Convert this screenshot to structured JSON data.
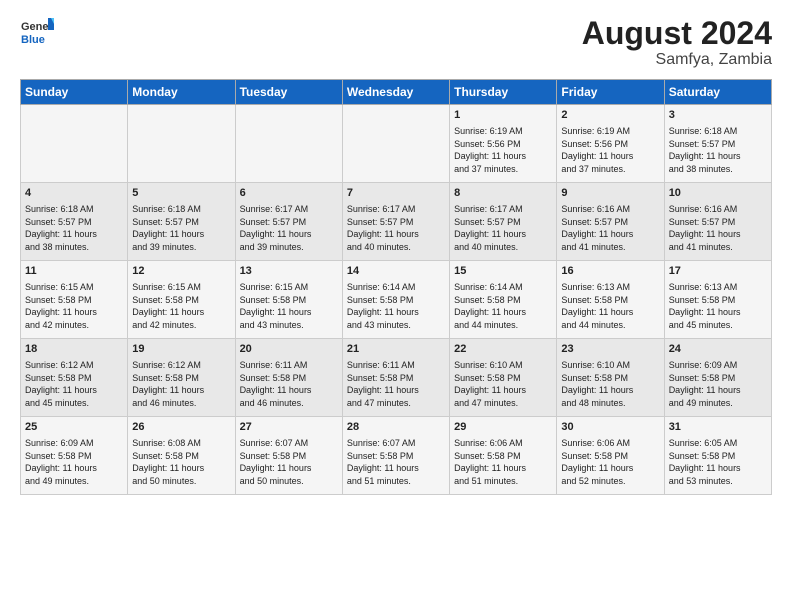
{
  "logo": {
    "general": "General",
    "blue": "Blue"
  },
  "title": "August 2024",
  "subtitle": "Samfya, Zambia",
  "days_of_week": [
    "Sunday",
    "Monday",
    "Tuesday",
    "Wednesday",
    "Thursday",
    "Friday",
    "Saturday"
  ],
  "weeks": [
    [
      {
        "day": "",
        "content": ""
      },
      {
        "day": "",
        "content": ""
      },
      {
        "day": "",
        "content": ""
      },
      {
        "day": "",
        "content": ""
      },
      {
        "day": "1",
        "content": "Sunrise: 6:19 AM\nSunset: 5:56 PM\nDaylight: 11 hours\nand 37 minutes."
      },
      {
        "day": "2",
        "content": "Sunrise: 6:19 AM\nSunset: 5:56 PM\nDaylight: 11 hours\nand 37 minutes."
      },
      {
        "day": "3",
        "content": "Sunrise: 6:18 AM\nSunset: 5:57 PM\nDaylight: 11 hours\nand 38 minutes."
      }
    ],
    [
      {
        "day": "4",
        "content": "Sunrise: 6:18 AM\nSunset: 5:57 PM\nDaylight: 11 hours\nand 38 minutes."
      },
      {
        "day": "5",
        "content": "Sunrise: 6:18 AM\nSunset: 5:57 PM\nDaylight: 11 hours\nand 39 minutes."
      },
      {
        "day": "6",
        "content": "Sunrise: 6:17 AM\nSunset: 5:57 PM\nDaylight: 11 hours\nand 39 minutes."
      },
      {
        "day": "7",
        "content": "Sunrise: 6:17 AM\nSunset: 5:57 PM\nDaylight: 11 hours\nand 40 minutes."
      },
      {
        "day": "8",
        "content": "Sunrise: 6:17 AM\nSunset: 5:57 PM\nDaylight: 11 hours\nand 40 minutes."
      },
      {
        "day": "9",
        "content": "Sunrise: 6:16 AM\nSunset: 5:57 PM\nDaylight: 11 hours\nand 41 minutes."
      },
      {
        "day": "10",
        "content": "Sunrise: 6:16 AM\nSunset: 5:57 PM\nDaylight: 11 hours\nand 41 minutes."
      }
    ],
    [
      {
        "day": "11",
        "content": "Sunrise: 6:15 AM\nSunset: 5:58 PM\nDaylight: 11 hours\nand 42 minutes."
      },
      {
        "day": "12",
        "content": "Sunrise: 6:15 AM\nSunset: 5:58 PM\nDaylight: 11 hours\nand 42 minutes."
      },
      {
        "day": "13",
        "content": "Sunrise: 6:15 AM\nSunset: 5:58 PM\nDaylight: 11 hours\nand 43 minutes."
      },
      {
        "day": "14",
        "content": "Sunrise: 6:14 AM\nSunset: 5:58 PM\nDaylight: 11 hours\nand 43 minutes."
      },
      {
        "day": "15",
        "content": "Sunrise: 6:14 AM\nSunset: 5:58 PM\nDaylight: 11 hours\nand 44 minutes."
      },
      {
        "day": "16",
        "content": "Sunrise: 6:13 AM\nSunset: 5:58 PM\nDaylight: 11 hours\nand 44 minutes."
      },
      {
        "day": "17",
        "content": "Sunrise: 6:13 AM\nSunset: 5:58 PM\nDaylight: 11 hours\nand 45 minutes."
      }
    ],
    [
      {
        "day": "18",
        "content": "Sunrise: 6:12 AM\nSunset: 5:58 PM\nDaylight: 11 hours\nand 45 minutes."
      },
      {
        "day": "19",
        "content": "Sunrise: 6:12 AM\nSunset: 5:58 PM\nDaylight: 11 hours\nand 46 minutes."
      },
      {
        "day": "20",
        "content": "Sunrise: 6:11 AM\nSunset: 5:58 PM\nDaylight: 11 hours\nand 46 minutes."
      },
      {
        "day": "21",
        "content": "Sunrise: 6:11 AM\nSunset: 5:58 PM\nDaylight: 11 hours\nand 47 minutes."
      },
      {
        "day": "22",
        "content": "Sunrise: 6:10 AM\nSunset: 5:58 PM\nDaylight: 11 hours\nand 47 minutes."
      },
      {
        "day": "23",
        "content": "Sunrise: 6:10 AM\nSunset: 5:58 PM\nDaylight: 11 hours\nand 48 minutes."
      },
      {
        "day": "24",
        "content": "Sunrise: 6:09 AM\nSunset: 5:58 PM\nDaylight: 11 hours\nand 49 minutes."
      }
    ],
    [
      {
        "day": "25",
        "content": "Sunrise: 6:09 AM\nSunset: 5:58 PM\nDaylight: 11 hours\nand 49 minutes."
      },
      {
        "day": "26",
        "content": "Sunrise: 6:08 AM\nSunset: 5:58 PM\nDaylight: 11 hours\nand 50 minutes."
      },
      {
        "day": "27",
        "content": "Sunrise: 6:07 AM\nSunset: 5:58 PM\nDaylight: 11 hours\nand 50 minutes."
      },
      {
        "day": "28",
        "content": "Sunrise: 6:07 AM\nSunset: 5:58 PM\nDaylight: 11 hours\nand 51 minutes."
      },
      {
        "day": "29",
        "content": "Sunrise: 6:06 AM\nSunset: 5:58 PM\nDaylight: 11 hours\nand 51 minutes."
      },
      {
        "day": "30",
        "content": "Sunrise: 6:06 AM\nSunset: 5:58 PM\nDaylight: 11 hours\nand 52 minutes."
      },
      {
        "day": "31",
        "content": "Sunrise: 6:05 AM\nSunset: 5:58 PM\nDaylight: 11 hours\nand 53 minutes."
      }
    ]
  ]
}
